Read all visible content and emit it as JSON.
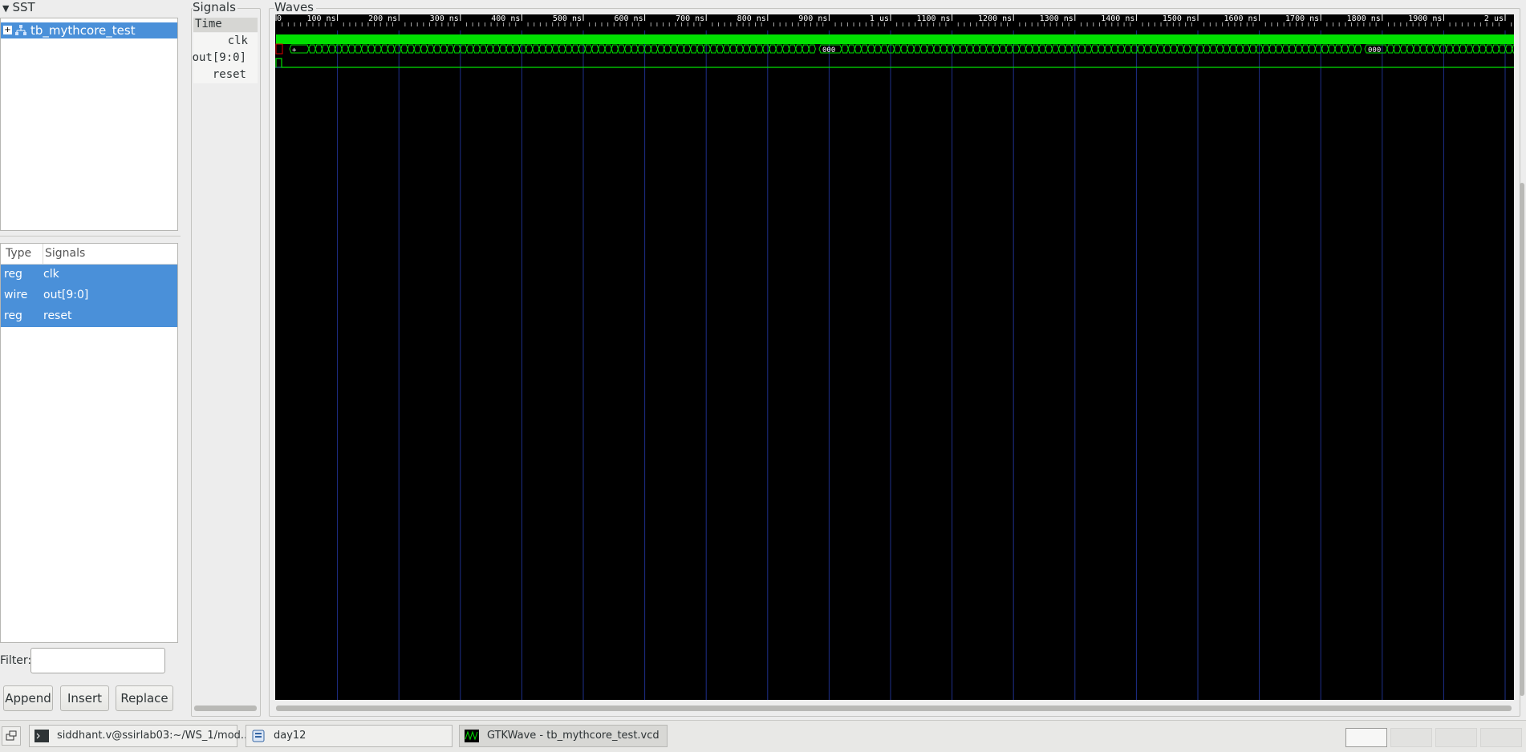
{
  "sst": {
    "title": "SST",
    "tree_item": "tb_mythcore_test"
  },
  "signal_list": {
    "headers": {
      "type": "Type",
      "signals": "Signals"
    },
    "rows": [
      {
        "type": "reg",
        "name": "clk"
      },
      {
        "type": "wire",
        "name": "out[9:0]"
      },
      {
        "type": "reg",
        "name": "reset"
      }
    ]
  },
  "filter": {
    "label": "Filter:",
    "value": ""
  },
  "buttons": {
    "append": "Append",
    "insert": "Insert",
    "replace": "Replace"
  },
  "signals_panel": {
    "title": "Signals",
    "time_label": "Time",
    "names": [
      "clk",
      "out[9:0]",
      "reset"
    ]
  },
  "waves_panel": {
    "title": "Waves",
    "timeline_labels": [
      "0",
      "100 ns",
      "200 ns",
      "300 ns",
      "400 ns",
      "500 ns",
      "600 ns",
      "700 ns",
      "800 ns",
      "900 ns",
      "1 us",
      "1100 ns",
      "1200 ns",
      "1300 ns",
      "1400 ns",
      "1500 ns",
      "1600 ns",
      "1700 ns",
      "1800 ns",
      "1900 ns",
      "2 us"
    ],
    "out_value_labels": [
      "+",
      "000",
      "000"
    ],
    "colors": {
      "signal": "#00e000",
      "grid": "#1e2f8a",
      "unknown": "#e00000",
      "background": "#000000"
    }
  },
  "taskbar": {
    "items": [
      {
        "label": "siddhant.v@ssirlab03:~/WS_1/mod...",
        "icon": "terminal-icon"
      },
      {
        "label": "day12",
        "icon": "folder-icon"
      },
      {
        "label": "GTKWave - tb_mythcore_test.vcd",
        "icon": "gtkwave-icon"
      }
    ]
  }
}
